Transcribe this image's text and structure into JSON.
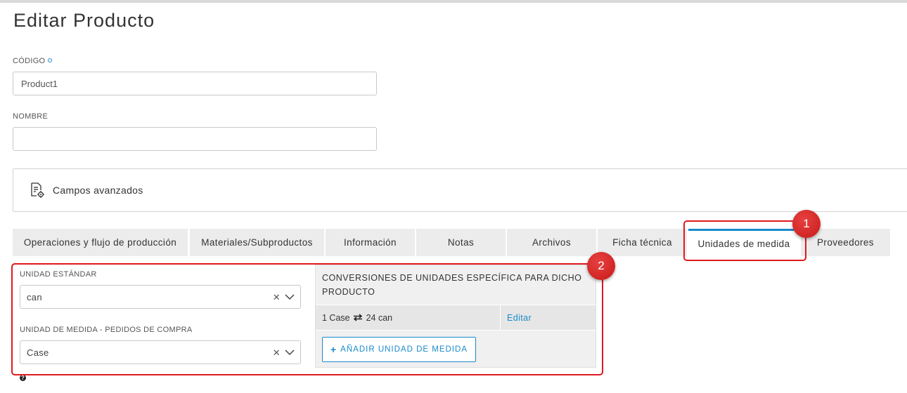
{
  "page": {
    "title": "Editar Producto"
  },
  "form": {
    "code": {
      "label": "CÓDIGO",
      "value": "Product1"
    },
    "name": {
      "label": "NOMBRE",
      "value": ""
    }
  },
  "advanced": {
    "label": "Campos avanzados",
    "icon": "document-settings-icon"
  },
  "tabs": [
    {
      "label": "Operaciones y flujo de producción",
      "active": false
    },
    {
      "label": "Materiales/Subproductos",
      "active": false
    },
    {
      "label": "Información",
      "active": false
    },
    {
      "label": "Notas",
      "active": false
    },
    {
      "label": "Archivos",
      "active": false
    },
    {
      "label": "Ficha técnica",
      "active": false
    },
    {
      "label": "Unidades de medida",
      "active": true
    },
    {
      "label": "Proveedores",
      "active": false
    }
  ],
  "units": {
    "standard": {
      "label": "UNIDAD ESTÁNDAR",
      "value": "can"
    },
    "purchase": {
      "label": "UNIDAD DE MEDIDA - PEDIDOS DE COMPRA",
      "value": "Case"
    }
  },
  "conversions": {
    "title": "CONVERSIONES DE UNIDADES ESPECÍFICA PARA DICHO PRODUCTO",
    "rows": [
      {
        "from": "1 Case",
        "to": "24 can",
        "edit_label": "Editar"
      }
    ],
    "add_label": "AÑADIR UNIDAD DE MEDIDA"
  },
  "annotations": [
    {
      "number": "1"
    },
    {
      "number": "2"
    }
  ],
  "colors": {
    "accent": "#1a8acb",
    "annotation": "#e0191e"
  }
}
